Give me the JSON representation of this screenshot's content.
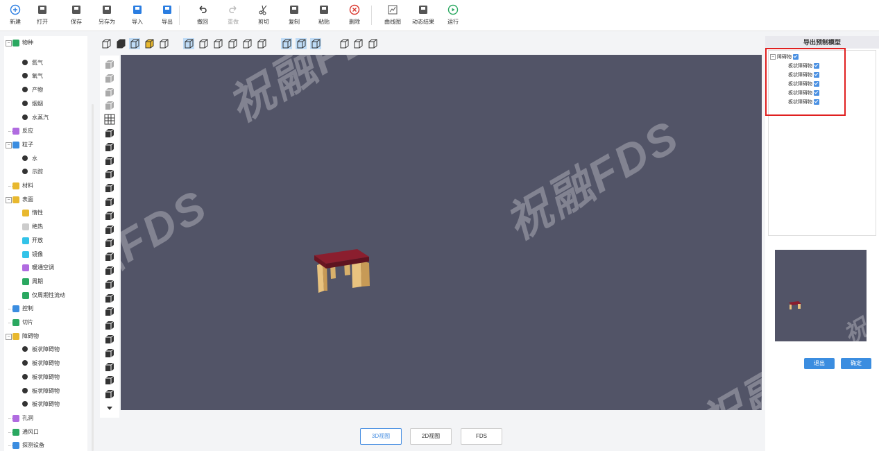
{
  "toolbar": {
    "items": [
      {
        "label": "新建",
        "icon": "plus-circle-icon"
      },
      {
        "label": "打开",
        "icon": "folder-open-icon"
      },
      {
        "label": "保存",
        "icon": "save-icon"
      },
      {
        "label": "另存为",
        "icon": "save-as-icon"
      },
      {
        "label": "导入",
        "icon": "import-icon"
      },
      {
        "label": "导出",
        "icon": "export-icon"
      },
      {
        "label": "撤回",
        "icon": "undo-icon"
      },
      {
        "label": "重做",
        "icon": "redo-icon"
      },
      {
        "label": "剪切",
        "icon": "scissors-icon"
      },
      {
        "label": "复制",
        "icon": "copy-icon"
      },
      {
        "label": "粘贴",
        "icon": "paste-icon"
      },
      {
        "label": "删除",
        "icon": "delete-icon"
      },
      {
        "label": "曲线图",
        "icon": "line-chart-icon"
      },
      {
        "label": "动态结果",
        "icon": "dynamic-result-icon"
      },
      {
        "label": "运行",
        "icon": "play-circle-icon"
      }
    ]
  },
  "tree": {
    "items": [
      {
        "label": "物种",
        "level": 0,
        "expander": "−"
      },
      {
        "label": "氮气",
        "level": 1
      },
      {
        "label": "氧气",
        "level": 1
      },
      {
        "label": "产物",
        "level": 1
      },
      {
        "label": "烟烟",
        "level": 1
      },
      {
        "label": "水蒸汽",
        "level": 1
      },
      {
        "label": "反应",
        "level": 0
      },
      {
        "label": "粒子",
        "level": 0,
        "expander": "−"
      },
      {
        "label": "水",
        "level": 1
      },
      {
        "label": "示踪",
        "level": 1
      },
      {
        "label": "材料",
        "level": 0
      },
      {
        "label": "表面",
        "level": 0,
        "expander": "−"
      },
      {
        "label": "惰性",
        "level": 1
      },
      {
        "label": "绝热",
        "level": 1
      },
      {
        "label": "开放",
        "level": 1
      },
      {
        "label": "镜像",
        "level": 1
      },
      {
        "label": "暖通空调",
        "level": 1
      },
      {
        "label": "周期",
        "level": 1
      },
      {
        "label": "仅周期性流动",
        "level": 1
      },
      {
        "label": "控制",
        "level": 0
      },
      {
        "label": "切片",
        "level": 0
      },
      {
        "label": "障碍物",
        "level": 0,
        "expander": "−"
      },
      {
        "label": "板状障碍物",
        "level": 1
      },
      {
        "label": "板状障碍物",
        "level": 1
      },
      {
        "label": "板状障碍物",
        "level": 1
      },
      {
        "label": "板状障碍物",
        "level": 1
      },
      {
        "label": "板状障碍物",
        "level": 1
      },
      {
        "label": "孔洞",
        "level": 0
      },
      {
        "label": "通风口",
        "level": 0
      },
      {
        "label": "探测设备",
        "level": 0
      }
    ]
  },
  "canvas": {
    "watermark": "祝融FDS",
    "background": "#525467"
  },
  "view_tabs": [
    "3D视图",
    "2D视图",
    "FDS"
  ],
  "right_panel": {
    "title": "导出预制模型",
    "root": "障碍物",
    "children": [
      "板状障碍物",
      "板状障碍物",
      "板状障碍物",
      "板状障碍物",
      "板状障碍物"
    ],
    "cancel": "退出",
    "confirm": "确定"
  }
}
